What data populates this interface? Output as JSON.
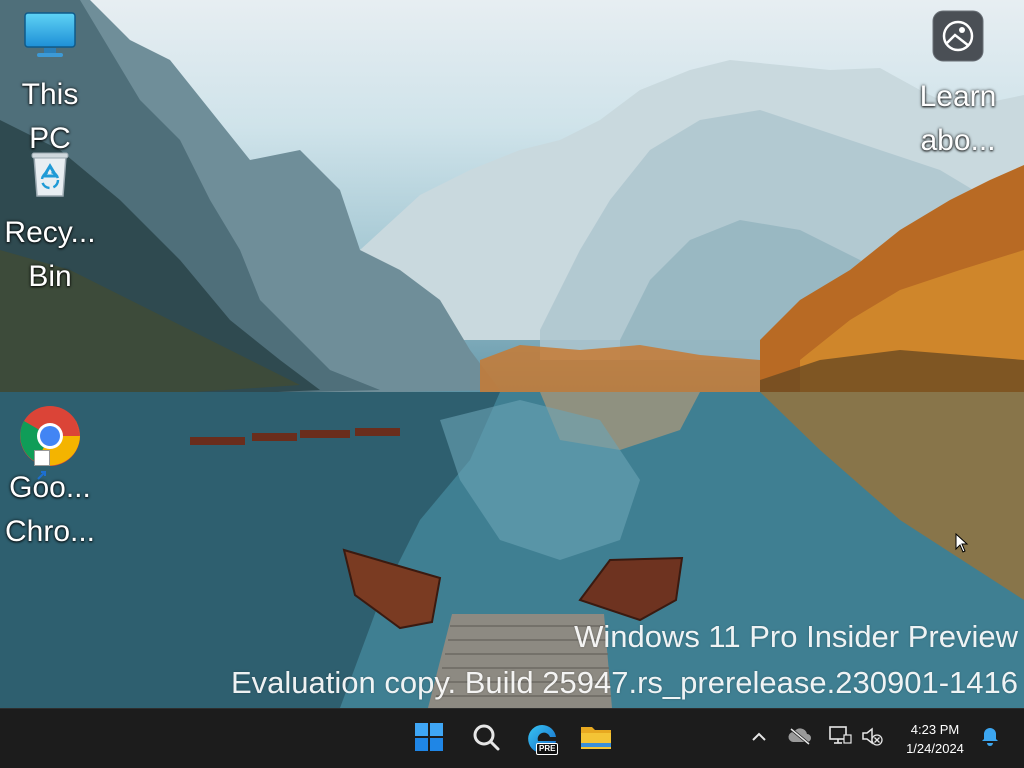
{
  "desktop": {
    "icons": [
      {
        "name": "This PC",
        "label": "This\nPC"
      },
      {
        "name": "Recycle Bin",
        "label": "Recy...\nBin"
      },
      {
        "name": "Google Chrome",
        "label": "Goo...\nChro..."
      },
      {
        "name": "Learn about this picture",
        "label": "Learn\nabo..."
      }
    ]
  },
  "watermark": {
    "line1": "Windows 11 Pro Insider Preview",
    "line2": "Evaluation copy. Build 25947.rs_prerelease.230901-1416"
  },
  "taskbar": {
    "pinned": [
      "start-icon",
      "search-icon",
      "edge-preview-icon",
      "file-explorer-icon"
    ],
    "edge_badge": "PRE",
    "tray": [
      "chevron-up-icon",
      "onedrive-offline-icon",
      "network-icon",
      "volume-muted-icon"
    ],
    "clock": {
      "time": "4:23 PM",
      "date": "1/24/2024"
    },
    "notification": "bell-icon"
  },
  "colors": {
    "taskbar_bg": "#1c1c1c",
    "start_blue": "#2f8ef0",
    "folder_yellow": "#f4c435"
  }
}
